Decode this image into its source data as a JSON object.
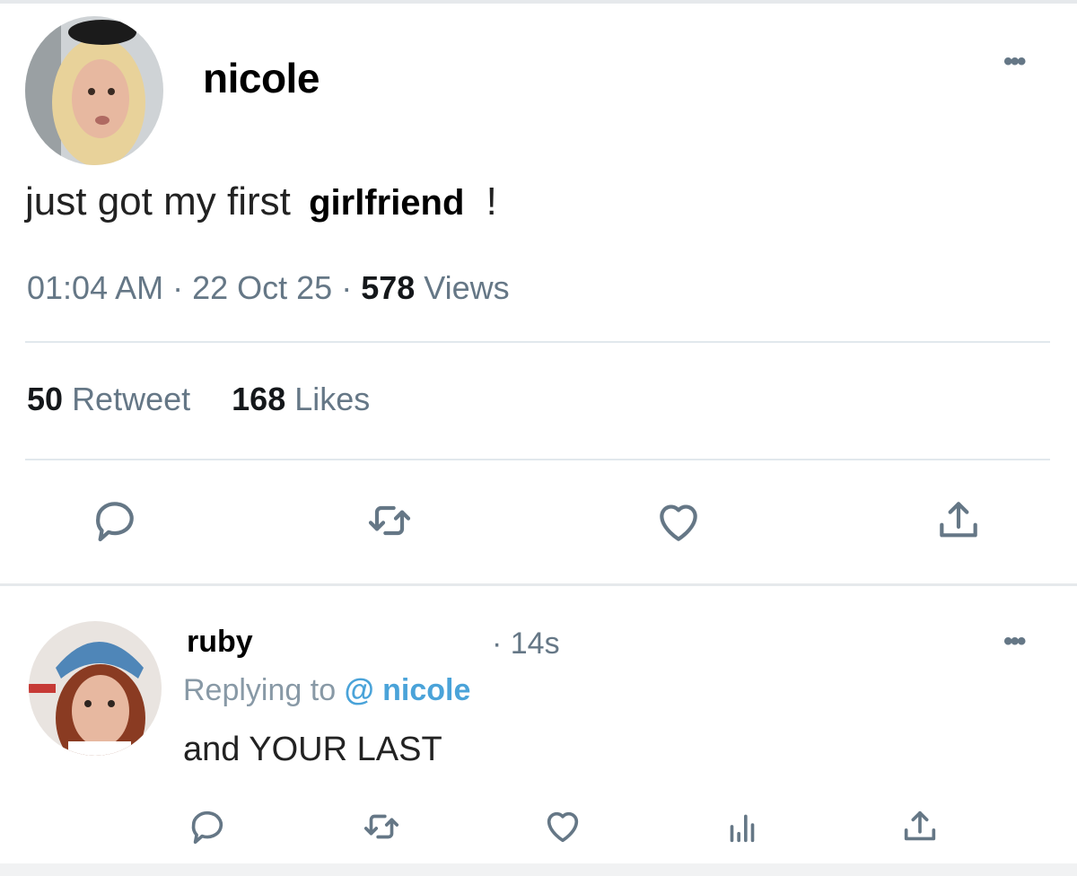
{
  "tweet": {
    "author": "nicole",
    "text_before": "just got my first",
    "text_highlight": "girlfriend",
    "text_after": "!",
    "time": "01:04 AM",
    "date": "22 Oct 25",
    "views_count": "578",
    "views_label": "Views",
    "retweets_count": "50",
    "retweets_label": "Retweet",
    "likes_count": "168",
    "likes_label": "Likes",
    "more": "•••"
  },
  "reply": {
    "author": "ruby",
    "time": "· 14s",
    "replying_label": "Replying to",
    "mention": "@ nicole",
    "text": "and YOUR LAST",
    "more": "•••"
  },
  "icons": [
    "reply-icon",
    "retweet-icon",
    "like-icon",
    "share-icon",
    "analytics-icon"
  ],
  "colors": {
    "icon": "#657786",
    "mention": "#4aa3d9",
    "divider": "#e1e8ed"
  }
}
